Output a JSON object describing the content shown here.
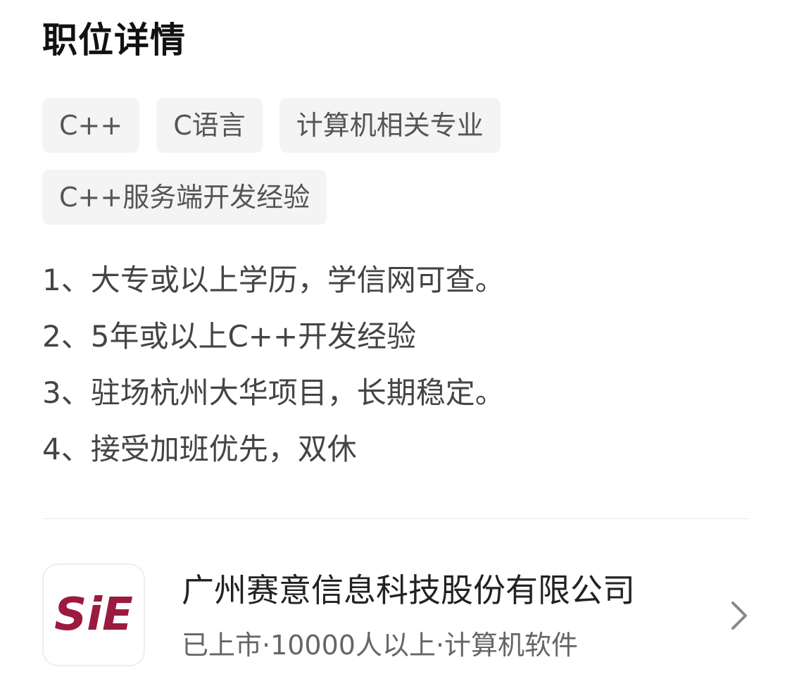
{
  "section": {
    "title": "职位详情"
  },
  "tags": {
    "row1": [
      "C++",
      "C语言",
      "计算机相关专业"
    ],
    "row2": [
      "C++服务端开发经验"
    ]
  },
  "description": [
    "1、大专或以上学历，学信网可查。",
    "2、5年或以上C++开发经验",
    "3、驻场杭州大华项目，长期稳定。",
    "4、接受加班优先，双休"
  ],
  "company": {
    "logo_text": "SiE",
    "name": "广州赛意信息科技股份有限公司",
    "meta": "已上市·10000人以上·计算机软件",
    "brand_color": "#9a1b3d",
    "chevron_icon": "chevron-right-icon"
  }
}
